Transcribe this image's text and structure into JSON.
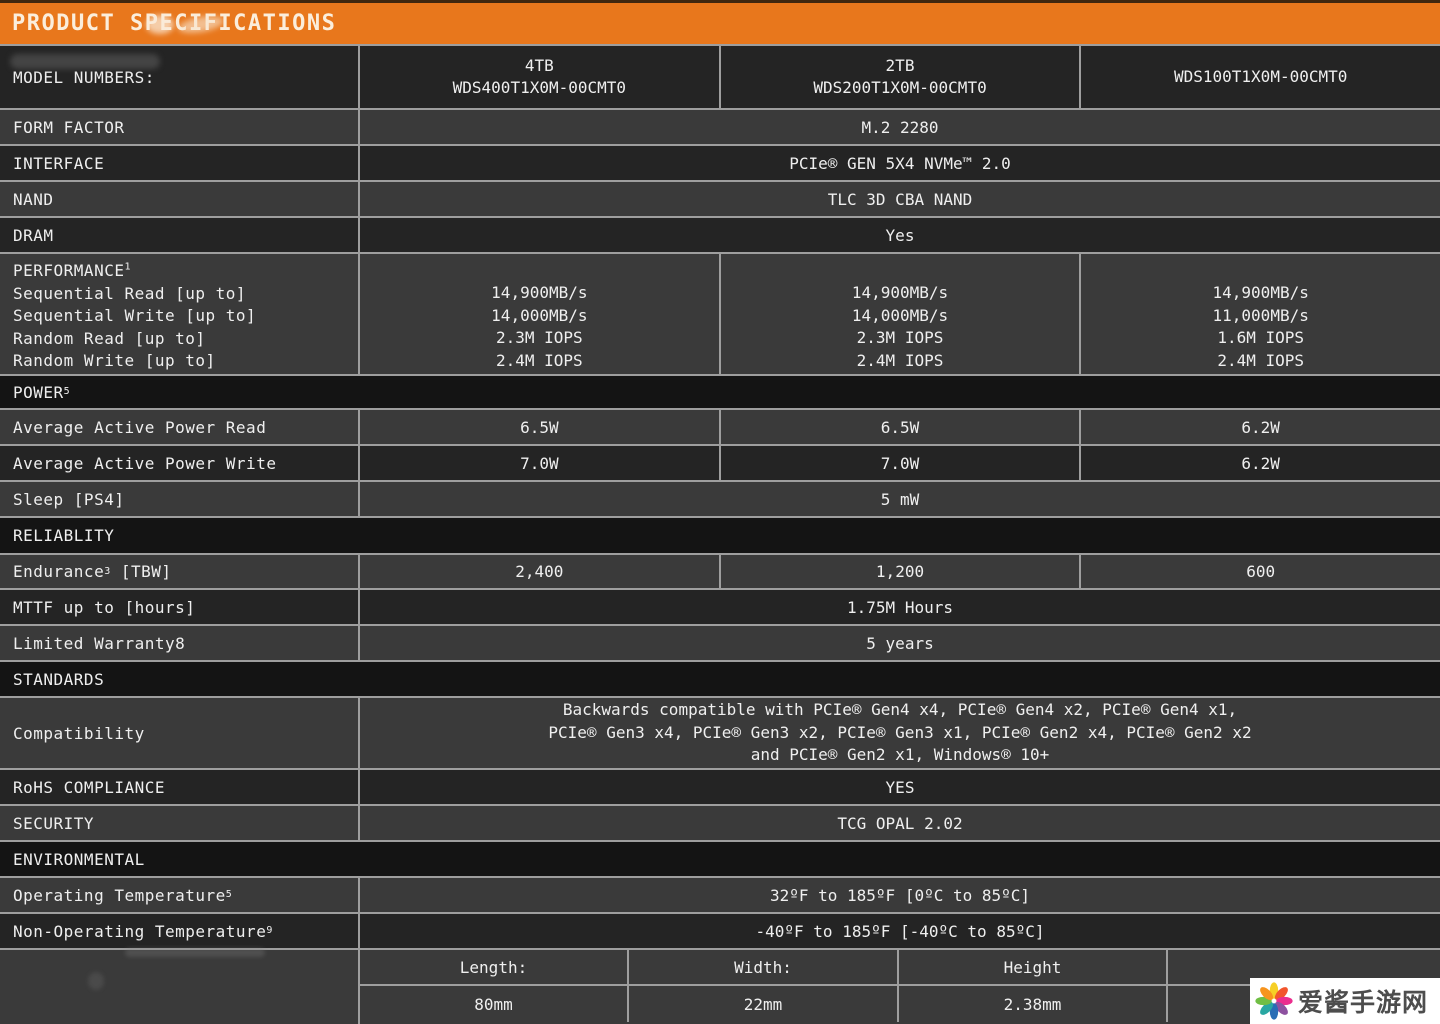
{
  "page_title": "PRODUCT SPECIFICATIONS",
  "colors": {
    "accent_orange": "#E8771C",
    "row_dark": "#242424",
    "row_light": "#3A3A3A",
    "section_black": "#141414",
    "border_gray": "#9E9E9E"
  },
  "model_row": {
    "label": "MODEL NUMBERS:",
    "columns": [
      {
        "capacity": "4TB",
        "model": "WDS400T1X0M-00CMT0"
      },
      {
        "capacity": "2TB",
        "model": "WDS200T1X0M-00CMT0"
      },
      {
        "capacity": "",
        "model": "WDS100T1X0M-00CMT0"
      }
    ]
  },
  "rows": {
    "form_factor": {
      "label": "FORM FACTOR",
      "value": "M.2 2280"
    },
    "interface": {
      "label": "INTERFACE",
      "value": "PCIe® GEN 5X4 NVMe™ 2.0"
    },
    "nand": {
      "label": "NAND",
      "value": "TLC 3D CBA NAND"
    },
    "dram": {
      "label": "DRAM",
      "value": "Yes"
    }
  },
  "performance": {
    "heading": "PERFORMANCE",
    "heading_sup": "1",
    "metric_labels": [
      "Sequential Read [up to]",
      "Sequential Write [up to]",
      "Random Read [up to]",
      "Random Write [up to]"
    ],
    "columns": [
      [
        "14,900MB/s",
        "14,000MB/s",
        "2.3M IOPS",
        "2.4M IOPS"
      ],
      [
        "14,900MB/s",
        "14,000MB/s",
        "2.3M IOPS",
        "2.4M IOPS"
      ],
      [
        "14,900MB/s",
        "11,000MB/s",
        "1.6M IOPS",
        "2.4M IOPS"
      ]
    ]
  },
  "power": {
    "heading": "POWER",
    "heading_sup": "5",
    "read": {
      "label": "Average Active Power Read",
      "values": [
        "6.5W",
        "6.5W",
        "6.2W"
      ]
    },
    "write": {
      "label": "Average Active Power Write",
      "values": [
        "7.0W",
        "7.0W",
        "6.2W"
      ]
    },
    "sleep": {
      "label": "Sleep [PS4]",
      "value": "5 mW"
    }
  },
  "reliability": {
    "heading": "RELIABLITY",
    "endurance": {
      "label": "Endurance",
      "label_sup": "3",
      "label_suffix": " [TBW]",
      "values": [
        "2,400",
        "1,200",
        "600"
      ]
    },
    "mttf": {
      "label": "MTTF up to [hours]",
      "value": "1.75M Hours"
    },
    "warranty": {
      "label": "Limited Warranty8",
      "value": "5 years"
    }
  },
  "standards": {
    "heading": "STANDARDS",
    "compatibility": {
      "label": "Compatibility",
      "lines": [
        "Backwards compatible with PCIe® Gen4 x4, PCIe® Gen4 x2, PCIe® Gen4 x1,",
        "PCIe® Gen3 x4, PCIe® Gen3 x2, PCIe® Gen3 x1, PCIe® Gen2 x4, PCIe® Gen2 x2",
        "and PCIe® Gen2 x1, Windows® 10+"
      ]
    },
    "rohs": {
      "label": "RoHS COMPLIANCE",
      "value": "YES"
    },
    "security": {
      "label": "SECURITY",
      "value": "TCG OPAL 2.02"
    }
  },
  "environmental": {
    "heading": "ENVIRONMENTAL",
    "operating": {
      "label": "Operating Temperature",
      "label_sup": "5",
      "value": "32ºF to 185ºF [0ºC to 85ºC]"
    },
    "non_operating": {
      "label": "Non-Operating Temperature",
      "label_sup": "9",
      "value": "-40ºF to 185ºF [-40ºC to 85ºC]"
    }
  },
  "dimensions": {
    "headers": [
      "Length:",
      "Width:",
      "Height"
    ],
    "values": [
      "80mm",
      "22mm",
      "2.38mm"
    ]
  },
  "watermark": {
    "text": "爱酱手游网",
    "petal_colors": [
      "#F6CF26",
      "#F2552C",
      "#EB2D8E",
      "#8E52A0",
      "#2A6DB5",
      "#29A7A2",
      "#70BE44",
      "#F7941D"
    ]
  }
}
